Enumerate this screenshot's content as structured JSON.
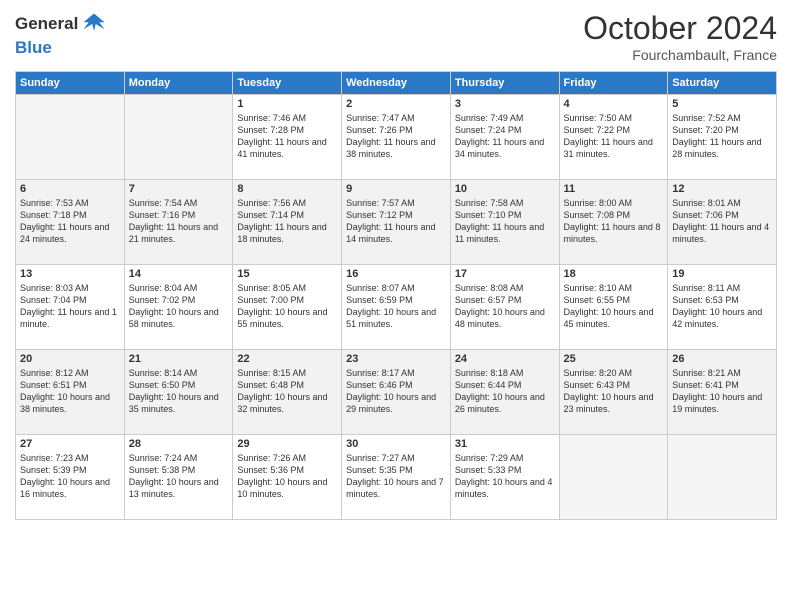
{
  "header": {
    "logo_line1": "General",
    "logo_line2": "Blue",
    "month": "October 2024",
    "location": "Fourchambault, France"
  },
  "days_of_week": [
    "Sunday",
    "Monday",
    "Tuesday",
    "Wednesday",
    "Thursday",
    "Friday",
    "Saturday"
  ],
  "weeks": [
    [
      {
        "day": "",
        "sunrise": "",
        "sunset": "",
        "daylight": ""
      },
      {
        "day": "",
        "sunrise": "",
        "sunset": "",
        "daylight": ""
      },
      {
        "day": "1",
        "sunrise": "Sunrise: 7:46 AM",
        "sunset": "Sunset: 7:28 PM",
        "daylight": "Daylight: 11 hours and 41 minutes."
      },
      {
        "day": "2",
        "sunrise": "Sunrise: 7:47 AM",
        "sunset": "Sunset: 7:26 PM",
        "daylight": "Daylight: 11 hours and 38 minutes."
      },
      {
        "day": "3",
        "sunrise": "Sunrise: 7:49 AM",
        "sunset": "Sunset: 7:24 PM",
        "daylight": "Daylight: 11 hours and 34 minutes."
      },
      {
        "day": "4",
        "sunrise": "Sunrise: 7:50 AM",
        "sunset": "Sunset: 7:22 PM",
        "daylight": "Daylight: 11 hours and 31 minutes."
      },
      {
        "day": "5",
        "sunrise": "Sunrise: 7:52 AM",
        "sunset": "Sunset: 7:20 PM",
        "daylight": "Daylight: 11 hours and 28 minutes."
      }
    ],
    [
      {
        "day": "6",
        "sunrise": "Sunrise: 7:53 AM",
        "sunset": "Sunset: 7:18 PM",
        "daylight": "Daylight: 11 hours and 24 minutes."
      },
      {
        "day": "7",
        "sunrise": "Sunrise: 7:54 AM",
        "sunset": "Sunset: 7:16 PM",
        "daylight": "Daylight: 11 hours and 21 minutes."
      },
      {
        "day": "8",
        "sunrise": "Sunrise: 7:56 AM",
        "sunset": "Sunset: 7:14 PM",
        "daylight": "Daylight: 11 hours and 18 minutes."
      },
      {
        "day": "9",
        "sunrise": "Sunrise: 7:57 AM",
        "sunset": "Sunset: 7:12 PM",
        "daylight": "Daylight: 11 hours and 14 minutes."
      },
      {
        "day": "10",
        "sunrise": "Sunrise: 7:58 AM",
        "sunset": "Sunset: 7:10 PM",
        "daylight": "Daylight: 11 hours and 11 minutes."
      },
      {
        "day": "11",
        "sunrise": "Sunrise: 8:00 AM",
        "sunset": "Sunset: 7:08 PM",
        "daylight": "Daylight: 11 hours and 8 minutes."
      },
      {
        "day": "12",
        "sunrise": "Sunrise: 8:01 AM",
        "sunset": "Sunset: 7:06 PM",
        "daylight": "Daylight: 11 hours and 4 minutes."
      }
    ],
    [
      {
        "day": "13",
        "sunrise": "Sunrise: 8:03 AM",
        "sunset": "Sunset: 7:04 PM",
        "daylight": "Daylight: 11 hours and 1 minute."
      },
      {
        "day": "14",
        "sunrise": "Sunrise: 8:04 AM",
        "sunset": "Sunset: 7:02 PM",
        "daylight": "Daylight: 10 hours and 58 minutes."
      },
      {
        "day": "15",
        "sunrise": "Sunrise: 8:05 AM",
        "sunset": "Sunset: 7:00 PM",
        "daylight": "Daylight: 10 hours and 55 minutes."
      },
      {
        "day": "16",
        "sunrise": "Sunrise: 8:07 AM",
        "sunset": "Sunset: 6:59 PM",
        "daylight": "Daylight: 10 hours and 51 minutes."
      },
      {
        "day": "17",
        "sunrise": "Sunrise: 8:08 AM",
        "sunset": "Sunset: 6:57 PM",
        "daylight": "Daylight: 10 hours and 48 minutes."
      },
      {
        "day": "18",
        "sunrise": "Sunrise: 8:10 AM",
        "sunset": "Sunset: 6:55 PM",
        "daylight": "Daylight: 10 hours and 45 minutes."
      },
      {
        "day": "19",
        "sunrise": "Sunrise: 8:11 AM",
        "sunset": "Sunset: 6:53 PM",
        "daylight": "Daylight: 10 hours and 42 minutes."
      }
    ],
    [
      {
        "day": "20",
        "sunrise": "Sunrise: 8:12 AM",
        "sunset": "Sunset: 6:51 PM",
        "daylight": "Daylight: 10 hours and 38 minutes."
      },
      {
        "day": "21",
        "sunrise": "Sunrise: 8:14 AM",
        "sunset": "Sunset: 6:50 PM",
        "daylight": "Daylight: 10 hours and 35 minutes."
      },
      {
        "day": "22",
        "sunrise": "Sunrise: 8:15 AM",
        "sunset": "Sunset: 6:48 PM",
        "daylight": "Daylight: 10 hours and 32 minutes."
      },
      {
        "day": "23",
        "sunrise": "Sunrise: 8:17 AM",
        "sunset": "Sunset: 6:46 PM",
        "daylight": "Daylight: 10 hours and 29 minutes."
      },
      {
        "day": "24",
        "sunrise": "Sunrise: 8:18 AM",
        "sunset": "Sunset: 6:44 PM",
        "daylight": "Daylight: 10 hours and 26 minutes."
      },
      {
        "day": "25",
        "sunrise": "Sunrise: 8:20 AM",
        "sunset": "Sunset: 6:43 PM",
        "daylight": "Daylight: 10 hours and 23 minutes."
      },
      {
        "day": "26",
        "sunrise": "Sunrise: 8:21 AM",
        "sunset": "Sunset: 6:41 PM",
        "daylight": "Daylight: 10 hours and 19 minutes."
      }
    ],
    [
      {
        "day": "27",
        "sunrise": "Sunrise: 7:23 AM",
        "sunset": "Sunset: 5:39 PM",
        "daylight": "Daylight: 10 hours and 16 minutes."
      },
      {
        "day": "28",
        "sunrise": "Sunrise: 7:24 AM",
        "sunset": "Sunset: 5:38 PM",
        "daylight": "Daylight: 10 hours and 13 minutes."
      },
      {
        "day": "29",
        "sunrise": "Sunrise: 7:26 AM",
        "sunset": "Sunset: 5:36 PM",
        "daylight": "Daylight: 10 hours and 10 minutes."
      },
      {
        "day": "30",
        "sunrise": "Sunrise: 7:27 AM",
        "sunset": "Sunset: 5:35 PM",
        "daylight": "Daylight: 10 hours and 7 minutes."
      },
      {
        "day": "31",
        "sunrise": "Sunrise: 7:29 AM",
        "sunset": "Sunset: 5:33 PM",
        "daylight": "Daylight: 10 hours and 4 minutes."
      },
      {
        "day": "",
        "sunrise": "",
        "sunset": "",
        "daylight": ""
      },
      {
        "day": "",
        "sunrise": "",
        "sunset": "",
        "daylight": ""
      }
    ]
  ]
}
